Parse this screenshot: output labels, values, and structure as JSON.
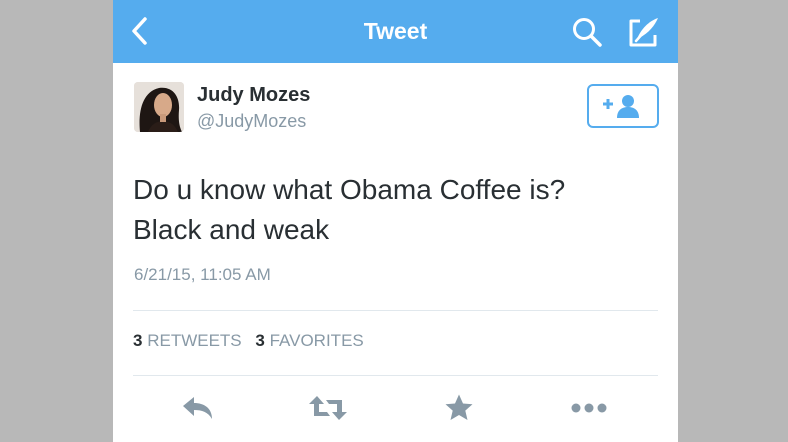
{
  "header": {
    "title": "Tweet"
  },
  "user": {
    "name": "Judy Mozes",
    "handle": "@JudyMozes"
  },
  "tweet": {
    "text_line1": "Do u know what Obama Coffee is?",
    "text_line2": "Black and weak",
    "timestamp": "6/21/15, 11:05 AM"
  },
  "stats": {
    "retweets_count": "3",
    "retweets_label": "RETWEETS",
    "favorites_count": "3",
    "favorites_label": "FAVORITES"
  },
  "icons": {
    "back": "back-chevron-icon",
    "search": "search-icon",
    "compose": "compose-icon",
    "follow": "add-user-icon",
    "reply": "reply-icon",
    "retweet": "retweet-icon",
    "favorite": "star-icon",
    "more": "more-dots-icon"
  },
  "colors": {
    "brand": "#55acee",
    "text": "#292f33",
    "muted": "#8899a6",
    "action_icons": "#8899a6"
  }
}
